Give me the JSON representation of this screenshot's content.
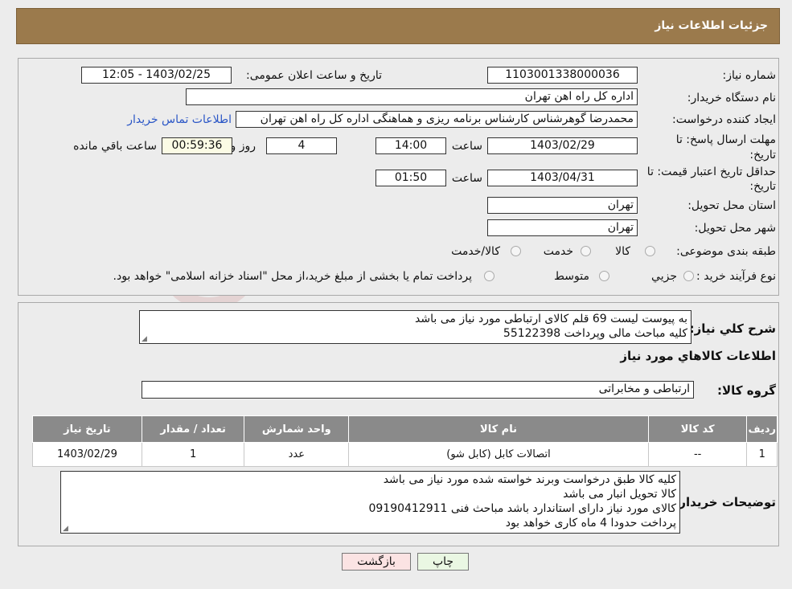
{
  "header": {
    "title": "جزئیات اطلاعات نیاز"
  },
  "form": {
    "need_number_label": "شماره نیاز:",
    "need_number": "1103001338000036",
    "announce_label": "تاریخ و ساعت اعلان عمومی:",
    "announce_value": "1403/02/25 - 12:05",
    "buyer_label": "نام دستگاه خریدار:",
    "buyer_value": "اداره کل راه اهن تهران",
    "creator_label": "ایجاد کننده درخواست:",
    "creator_value": "محمدرضا گوهرشناس کارشناس برنامه ریزی و هماهنگی اداره کل راه اهن تهران",
    "contact_link": "اطلاعات تماس خریدار",
    "deadline_label_1": "مهلت ارسال پاسخ: تا",
    "deadline_label_2": "تاریخ:",
    "deadline_date": "1403/02/29",
    "hour_label": "ساعت",
    "deadline_time": "14:00",
    "days_value": "4",
    "days_label": "روز و",
    "remaining_time": "00:59:36",
    "remaining_label": "ساعت باقي مانده",
    "validity_label_1": "حداقل تاریخ اعتبار قیمت: تا",
    "validity_label_2": "تاریخ:",
    "validity_date": "1403/04/31",
    "validity_time": "01:50",
    "province_label": "استان محل تحویل:",
    "province_value": "تهران",
    "city_label": "شهر محل تحویل:",
    "city_value": "تهران",
    "category_label": "طبقه بندی موضوعی:",
    "category_options": [
      "کالا",
      "خدمت",
      "کالا/خدمت"
    ],
    "purchase_label": "نوع فرآیند خرید :",
    "purchase_options": [
      "جزیي",
      "متوسط"
    ],
    "payment_note": "پرداخت تمام یا بخشی از مبلغ خرید،از محل \"اسناد خزانه اسلامی\" خواهد بود."
  },
  "description": {
    "label": "شرح كلي نياز:",
    "lines": [
      "به پیوست لیست 69 قلم کالای ارتباطی مورد نیاز می باشد",
      "کلیه مباحث مالی وپرداخت 55122398"
    ]
  },
  "goods": {
    "section_title": "اطلاعات كالاهاي مورد نياز",
    "group_label": "گروه کالا:",
    "group_value": "ارتباطی و مخابراتی",
    "columns": [
      "رديف",
      "کد کالا",
      "نام کالا",
      "واحد شمارش",
      "تعداد / مقدار",
      "تاریخ نیاز"
    ],
    "rows": [
      [
        "1",
        "--",
        "اتصالات کابل (کابل شو)",
        "عدد",
        "1",
        "1403/02/29"
      ]
    ]
  },
  "buyer_notes": {
    "label": "توضیحات خریدار:",
    "lines": [
      "کلیه کالا طبق درخواست وبرند خواسته شده مورد نیاز می باشد",
      "کالا تحویل انبار می باشد",
      "کالای مورد نیاز  دارای استاندارد باشد مباحث فنی 09190412911",
      "پرداخت حدودا 4 ماه کاری خواهد بود"
    ]
  },
  "buttons": {
    "print": "چاپ",
    "back": "بازگشت"
  },
  "colors": {
    "header_bg": "#9b7a4c",
    "table_header_bg": "#8a8a8a",
    "back_button_bg": "#fbe3e3",
    "print_button_bg": "#eaf7e3",
    "link": "#2a56c6"
  },
  "watermark": {
    "text": "AriaTender.neT"
  }
}
